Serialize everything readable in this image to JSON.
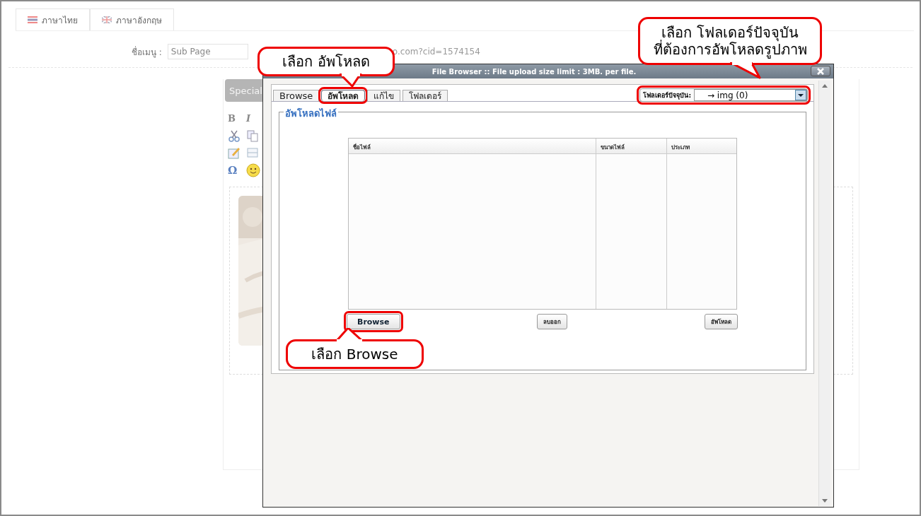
{
  "language_tabs": [
    {
      "label": "ภาษาไทย",
      "kind": "thai"
    },
    {
      "label": "ภาษาอังกฤษ",
      "kind": "uk"
    }
  ],
  "menu_name": {
    "label": "ชื่อเมนู :",
    "value": "Sub Page"
  },
  "url_text": "o.com?cid=1574154",
  "editor": {
    "special_button": "Special",
    "toolbar_glyphs": [
      "B",
      "I",
      "Ω"
    ]
  },
  "dialog": {
    "title": "File Browser :: File upload size limit : 3MB. per file.",
    "tabs": [
      {
        "label": "Browse",
        "selected": false,
        "highlighted": false
      },
      {
        "label": "อัพโหลด",
        "selected": true,
        "highlighted": true
      },
      {
        "label": "แก้ไข",
        "selected": false,
        "highlighted": false
      },
      {
        "label": "โฟลเดอร์",
        "selected": false,
        "highlighted": false
      }
    ],
    "folder": {
      "label": "โฟลเดอร์ปัจจุบัน:",
      "value": "→ img (0)",
      "highlighted": true
    },
    "fieldset_legend": "อัพโหลดไฟล์",
    "columns": [
      "ชื่อไฟล์",
      "ขนาดไฟล์",
      "ประเภท"
    ],
    "buttons": [
      {
        "label": "Browse",
        "highlighted": true
      },
      {
        "label": "ลบออก",
        "highlighted": false
      },
      {
        "label": "อัพโหลด",
        "highlighted": false
      }
    ]
  },
  "callouts": [
    {
      "lines": [
        "เลือก อัพโหลด"
      ]
    },
    {
      "lines": [
        "เลือก โฟลเดอร์ปัจจุบัน",
        "ที่ต้องการอัพโหลดรูปภาพ"
      ]
    },
    {
      "lines": [
        "เลือก Browse"
      ]
    }
  ]
}
